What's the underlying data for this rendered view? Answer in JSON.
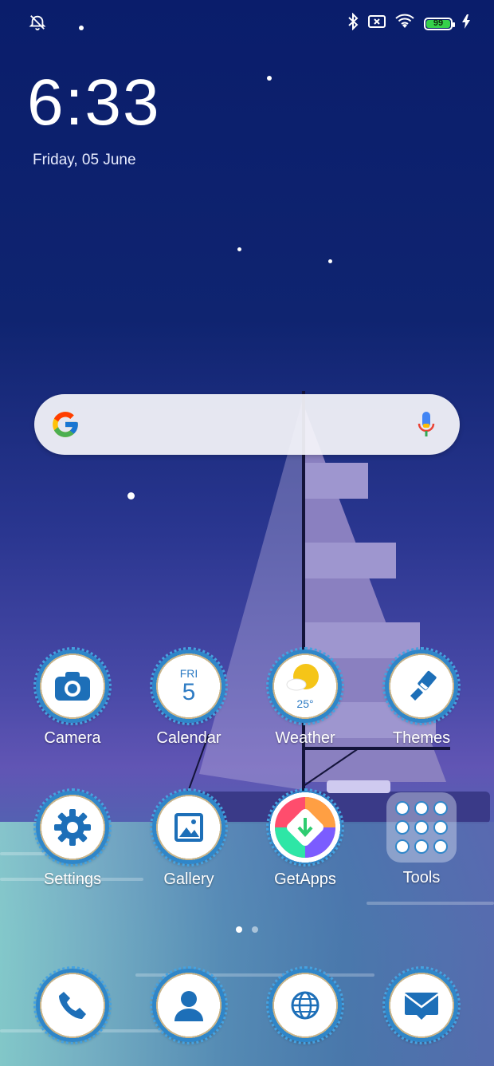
{
  "status_bar": {
    "battery_percent": "99",
    "icons": [
      "alarm-off-icon",
      "bluetooth-icon",
      "sim-none-icon",
      "wifi-icon",
      "battery-icon",
      "charging-icon"
    ]
  },
  "lock_widget": {
    "time": "6:33",
    "date": "Friday, 05 June"
  },
  "search_bar": {
    "icons": [
      "google-logo-icon",
      "microphone-icon"
    ]
  },
  "apps_row1": [
    {
      "label": "Camera",
      "icon": "camera-icon"
    },
    {
      "label": "Calendar",
      "icon": "calendar-icon",
      "day_name": "FRI",
      "day_number": "5"
    },
    {
      "label": "Weather",
      "icon": "weather-icon",
      "temperature": "25°"
    },
    {
      "label": "Themes",
      "icon": "paintbrush-icon"
    }
  ],
  "apps_row2": [
    {
      "label": "Settings",
      "icon": "gear-icon"
    },
    {
      "label": "Gallery",
      "icon": "gallery-icon"
    },
    {
      "label": "GetApps",
      "icon": "getapps-icon"
    },
    {
      "label": "Tools",
      "icon": "folder-icon"
    }
  ],
  "page_indicator": {
    "pages": 2,
    "current": 1
  },
  "dock": [
    {
      "icon": "phone-icon"
    },
    {
      "icon": "contacts-icon"
    },
    {
      "icon": "browser-icon"
    },
    {
      "icon": "mail-icon"
    }
  ],
  "colors": {
    "accent": "#2f86c9",
    "battery": "#35d14a"
  }
}
